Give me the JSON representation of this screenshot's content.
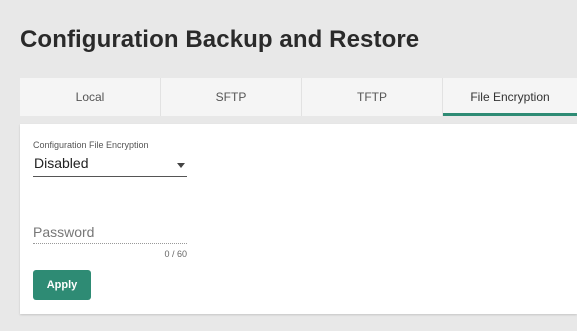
{
  "page": {
    "title": "Configuration Backup and Restore"
  },
  "tabs": [
    {
      "label": "Local",
      "active": false
    },
    {
      "label": "SFTP",
      "active": false
    },
    {
      "label": "TFTP",
      "active": false
    },
    {
      "label": "File Encryption",
      "active": true
    }
  ],
  "form": {
    "encryption_label": "Configuration File Encryption",
    "encryption_value": "Disabled",
    "password_placeholder": "Password",
    "password_value": "",
    "password_counter": "0 / 60",
    "apply_label": "Apply"
  },
  "colors": {
    "accent": "#2e8b74",
    "background": "#e8e8e8",
    "panel": "#ffffff"
  },
  "icons": {
    "select_caret": "caret-down-icon"
  }
}
